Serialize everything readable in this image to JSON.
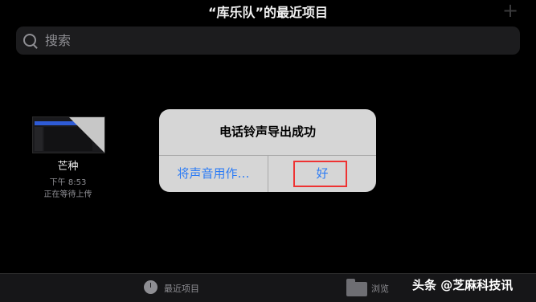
{
  "header": {
    "title": "“库乐队”的最近项目",
    "add_icon": "plus-icon"
  },
  "search": {
    "placeholder": "搜索",
    "icon": "search-icon"
  },
  "file": {
    "name": "芒种",
    "time": "下午 8:53",
    "status": "正在等待上传"
  },
  "alert": {
    "title": "电话铃声导出成功",
    "left_button": "将声音用作…",
    "right_button": "好",
    "accent_color": "#2b7bf5",
    "highlight_color": "#e33333"
  },
  "tabbar": {
    "recent_label": "最近项目",
    "recent_icon": "clock-icon",
    "browse_label": "浏览",
    "browse_icon": "folder-icon"
  },
  "watermark": {
    "text": "头条 @芝麻科技讯"
  }
}
